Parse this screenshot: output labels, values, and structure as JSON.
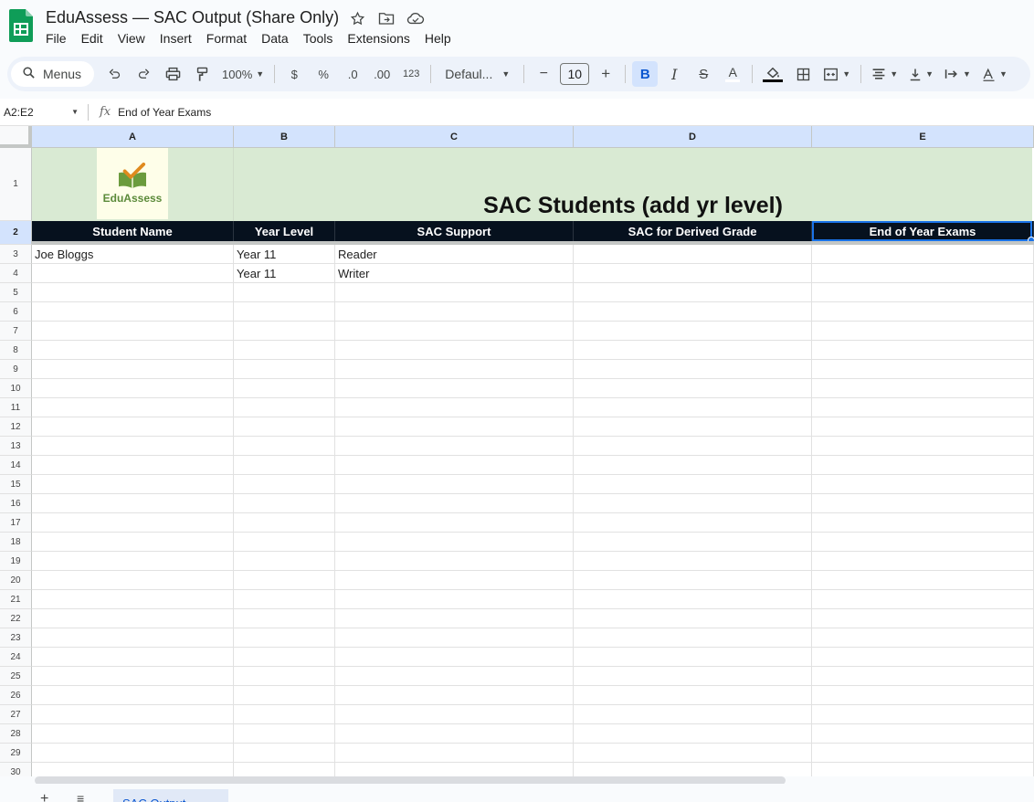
{
  "app": {
    "title": "EduAssess — SAC Output (Share Only)",
    "menu": [
      "File",
      "Edit",
      "View",
      "Insert",
      "Format",
      "Data",
      "Tools",
      "Extensions",
      "Help"
    ]
  },
  "toolbar": {
    "menus_label": "Menus",
    "zoom": "100%",
    "currency": "$",
    "percent": "%",
    "decrease_decimal": ".0",
    "increase_decimal": ".00",
    "number_format": "123",
    "font": "Defaul...",
    "font_size": "10",
    "minus": "−",
    "plus": "+",
    "bold": "B",
    "italic": "I",
    "strike": "S",
    "text_color": "A"
  },
  "formula_bar": {
    "name_box": "A2:E2",
    "fx": "fx",
    "value": "End of Year Exams"
  },
  "grid": {
    "columns": [
      "A",
      "B",
      "C",
      "D",
      "E"
    ],
    "rows": [
      "1",
      "2",
      "3",
      "4",
      "5",
      "6",
      "7",
      "8",
      "9",
      "10",
      "11",
      "12",
      "13",
      "14",
      "15",
      "16",
      "17",
      "18",
      "19",
      "20",
      "21",
      "22",
      "23",
      "24",
      "25",
      "26",
      "27",
      "28",
      "29",
      "30"
    ],
    "brand_name": "EduAssess",
    "banner_title": "SAC Students (add yr level)",
    "headers": [
      "Student Name",
      "Year Level",
      "SAC Support",
      "SAC for Derived Grade",
      "End of Year Exams"
    ],
    "data_rows": [
      [
        "Joe Bloggs",
        "Year 11",
        "Reader",
        "",
        ""
      ],
      [
        "",
        "Year 11",
        "Writer",
        "",
        ""
      ]
    ]
  },
  "sheets": {
    "add": "+",
    "all": "≡",
    "active": "SAC Output"
  },
  "colors": {
    "accent": "#0b57d0",
    "banner": "#d9ead3",
    "header_bg": "#06111e",
    "selection": "#1a73e8"
  }
}
